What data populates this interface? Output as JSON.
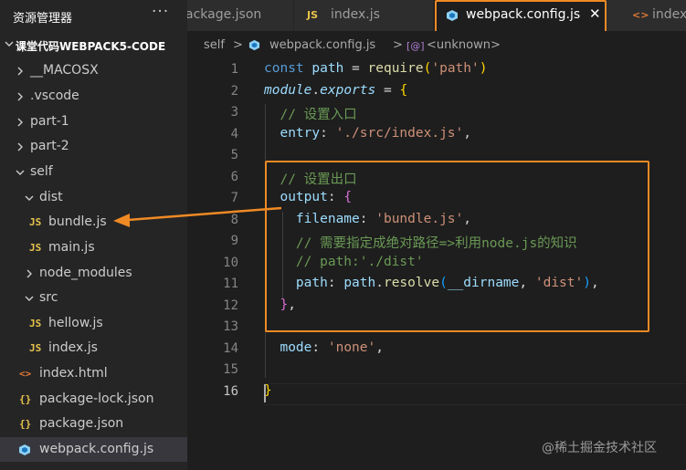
{
  "explorer": {
    "title": "资源管理器",
    "more": "···",
    "project": "课堂代码WEBPACK5-CODE",
    "items": [
      {
        "label": "__MACOSX",
        "type": "folder",
        "open": false,
        "depth": 0
      },
      {
        "label": ".vscode",
        "type": "folder",
        "open": false,
        "depth": 0
      },
      {
        "label": "part-1",
        "type": "folder",
        "open": false,
        "depth": 0
      },
      {
        "label": "part-2",
        "type": "folder",
        "open": false,
        "depth": 0
      },
      {
        "label": "self",
        "type": "folder",
        "open": true,
        "depth": 0
      },
      {
        "label": "dist",
        "type": "folder",
        "open": true,
        "depth": 1
      },
      {
        "label": "bundle.js",
        "type": "js",
        "depth": 2
      },
      {
        "label": "main.js",
        "type": "js",
        "depth": 2
      },
      {
        "label": "node_modules",
        "type": "folder",
        "open": false,
        "depth": 1
      },
      {
        "label": "src",
        "type": "folder",
        "open": true,
        "depth": 1
      },
      {
        "label": "hellow.js",
        "type": "js",
        "depth": 2
      },
      {
        "label": "index.js",
        "type": "js",
        "depth": 2
      },
      {
        "label": "index.html",
        "type": "html",
        "depth": 1
      },
      {
        "label": "package-lock.json",
        "type": "json",
        "depth": 1
      },
      {
        "label": "package.json",
        "type": "json",
        "depth": 1
      },
      {
        "label": "webpack.config.js",
        "type": "webpack",
        "depth": 1,
        "selected": true
      }
    ]
  },
  "tabs": [
    {
      "label": "ackage.json",
      "icon": ""
    },
    {
      "label": "index.js",
      "icon": "JS"
    },
    {
      "label": "webpack.config.js",
      "icon": "◆",
      "active": true,
      "close": "✕"
    },
    {
      "label": "index",
      "icon": "<>"
    }
  ],
  "breadcrumb": {
    "folder": "self",
    "sep": ">",
    "file": "webpack.config.js",
    "symbol_icon": "[@]",
    "symbol": "<unknown>"
  },
  "editor": {
    "line_numbers": [
      "1",
      "2",
      "3",
      "4",
      "5",
      "6",
      "7",
      "8",
      "9",
      "10",
      "11",
      "12",
      "13",
      "14",
      "15",
      "16"
    ],
    "current_line": 16,
    "code": {
      "l1": {
        "t1": "const",
        "t2": " path ",
        "t3": "=",
        "t4": " require",
        "t5": "(",
        "t6": "'path'",
        "t7": ")"
      },
      "l2": {
        "t1": "module",
        "t2": ".",
        "t3": "exports",
        "t4": " = ",
        "t5": "{"
      },
      "l3": {
        "t1": "  // 设置入口"
      },
      "l4": {
        "t1": "  entry",
        "t2": ": ",
        "t3": "'./src/index.js'",
        "t4": ","
      },
      "l6": {
        "t1": "  // 设置出口"
      },
      "l7": {
        "t1": "  output",
        "t2": ": ",
        "t3": "{"
      },
      "l8": {
        "t1": "    filename",
        "t2": ": ",
        "t3": "'bundle.js'",
        "t4": ","
      },
      "l9": {
        "t1": "    // 需要指定成绝对路径=>利用node.js的知识"
      },
      "l10": {
        "t1": "    // path:'./dist'"
      },
      "l11": {
        "t1": "    path",
        "t2": ": ",
        "t3": "path",
        "t4": ".",
        "t5": "resolve",
        "t6": "(",
        "t7": "__dirname",
        "t8": ", ",
        "t9": "'dist'",
        "t10": ")",
        "t11": ","
      },
      "l12": {
        "t1": "  }",
        "t2": ","
      },
      "l14": {
        "t1": "  mode",
        "t2": ": ",
        "t3": "'none'",
        "t4": ","
      },
      "l16": {
        "t1": "}"
      }
    }
  },
  "watermark": "@稀土掘金技术社区",
  "colors": {
    "annotation": "#f08a24",
    "background": "#1e1e1e",
    "sidebar": "#252526"
  }
}
